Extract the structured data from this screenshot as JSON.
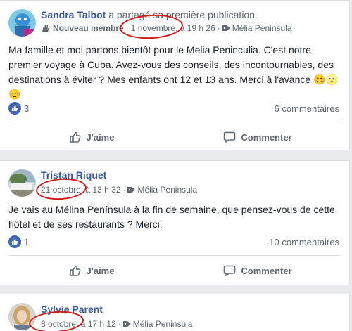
{
  "posts": [
    {
      "author": "Sandra Talbot",
      "action": "a partagé sa première publication.",
      "badge": "Nouveau membre",
      "date": "1 novembre, à 19 h 26",
      "place": "Mélia Peninsula",
      "text": "Ma famille et moi partons bientôt pour le Melia Peninculia. C'est notre premier voyage à Cuba. Avez-vous des conseils, des incontournables, des destinations à éviter ? Mes enfants ont 12 et 13 ans. Merci à l'avance 😊🌝😊",
      "likes": "3",
      "comments": "6 commentaires",
      "like_label": "J'aime",
      "comment_label": "Commenter"
    },
    {
      "author": "Tristan Riquet",
      "date": "21 octobre, à 13 h 32",
      "place": "Mélia Peninsula",
      "text": "Je vais au Mélina Península à la fin de semaine, que pensez-vous de cette hôtel et de ses restaurants ? Merci.",
      "likes": "1",
      "comments": "10 commentaires",
      "like_label": "J'aime",
      "comment_label": "Commenter"
    },
    {
      "author": "Sylvie Parent",
      "date": "8 octobre, à 17 h 12",
      "place": "Mélia Peninsula"
    }
  ],
  "colors": {
    "accent": "#385898",
    "highlight": "#d11a1a",
    "like": "#4267b2"
  }
}
